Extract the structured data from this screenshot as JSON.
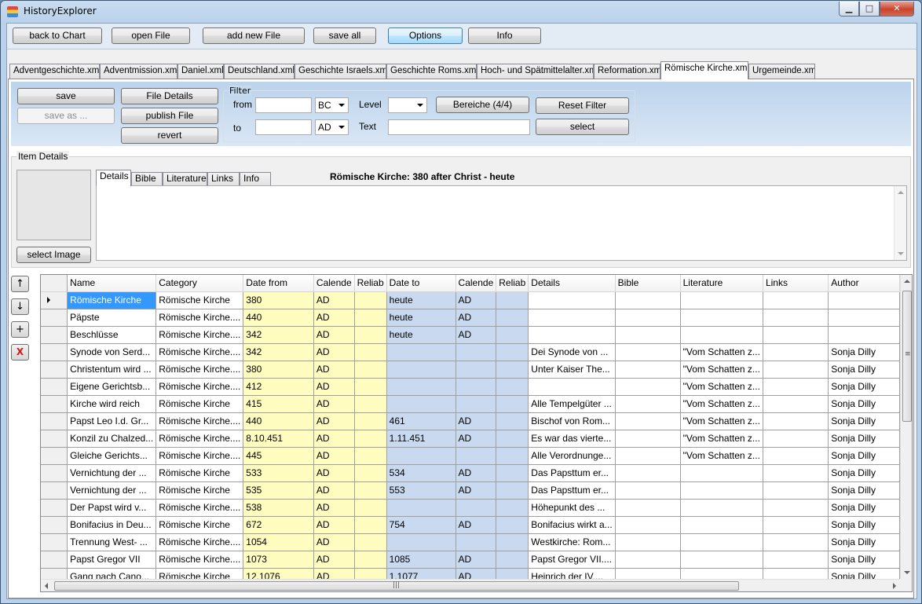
{
  "window": {
    "title": "HistoryExplorer",
    "minimize": "▁",
    "maximize": "□",
    "close": "✕"
  },
  "toolbar": {
    "back": "back to Chart",
    "open": "open File",
    "add": "add new File",
    "saveall": "save all",
    "options": "Options",
    "info": "Info"
  },
  "file_tabs": [
    "Adventgeschichte.xml",
    "Adventmission.xml",
    "Daniel.xml",
    "Deutschland.xml",
    "Geschichte Israels.xml",
    "Geschichte Roms.xml",
    "Hoch- und Spätmittelalter.xml",
    "Reformation.xml",
    "Römische Kirche.xml",
    "Urgemeinde.xml"
  ],
  "actions": {
    "save": "save",
    "save_as": "save as ...",
    "file_details": "File Details",
    "publish": "publish File",
    "revert": "revert"
  },
  "filter": {
    "legend": "Filter",
    "from_label": "from",
    "to_label": "to",
    "from_era": "BC",
    "to_era": "AD",
    "level_label": "Level",
    "level_value": "",
    "text_label": "Text",
    "bereiche": "Bereiche (4/4)",
    "reset": "Reset Filter",
    "select": "select"
  },
  "item_details": {
    "legend": "Item Details",
    "select_image": "select Image",
    "tabs": [
      "Details",
      "Bible",
      "Literature",
      "Links",
      "Info"
    ],
    "heading": "Römische Kirche:  380 after Christ  -  heute"
  },
  "side_buttons": {
    "up": "↑",
    "down": "↓",
    "add": "+",
    "delete": "X"
  },
  "grid": {
    "columns": [
      "Name",
      "Category",
      "Date from",
      "Calende",
      "Reliab",
      "Date to",
      "Calende",
      "Reliab",
      "Details",
      "Bible",
      "Literature",
      "Links",
      "Author"
    ],
    "rows": [
      [
        "Römische Kirche",
        "Römische Kirche",
        "380",
        "AD",
        "",
        "heute",
        "AD",
        "",
        "",
        "",
        "",
        "",
        ""
      ],
      [
        "Päpste",
        "Römische Kirche....",
        "440",
        "AD",
        "",
        "heute",
        "AD",
        "",
        "",
        "",
        "",
        "",
        ""
      ],
      [
        "Beschlüsse",
        "Römische Kirche....",
        "342",
        "AD",
        "",
        "heute",
        "AD",
        "",
        "",
        "",
        "",
        "",
        ""
      ],
      [
        "Synode von Serd...",
        "Römische Kirche....",
        "342",
        "AD",
        "",
        "",
        "",
        "",
        "Dei Synode von ...",
        "",
        "\"Vom Schatten z...",
        "",
        "Sonja Dilly"
      ],
      [
        "Christentum wird ...",
        "Römische Kirche....",
        "380",
        "AD",
        "",
        "",
        "",
        "",
        "Unter Kaiser The...",
        "",
        "\"Vom Schatten z...",
        "",
        "Sonja Dilly"
      ],
      [
        "Eigene Gerichtsb...",
        "Römische Kirche....",
        "412",
        "AD",
        "",
        "",
        "",
        "",
        "",
        "",
        "\"Vom Schatten z...",
        "",
        "Sonja Dilly"
      ],
      [
        "Kirche wird reich",
        "Römische Kirche",
        "415",
        "AD",
        "",
        "",
        "",
        "",
        "Alle Tempelgüter ...",
        "",
        "\"Vom Schatten z...",
        "",
        "Sonja Dilly"
      ],
      [
        "Papst Leo I.d. Gr...",
        "Römische Kirche....",
        "440",
        "AD",
        "",
        "461",
        "AD",
        "",
        "Bischof von Rom...",
        "",
        "\"Vom Schatten z...",
        "",
        "Sonja Dilly"
      ],
      [
        "Konzil zu Chalzed...",
        "Römische Kirche....",
        "8.10.451",
        "AD",
        "",
        "1.11.451",
        "AD",
        "",
        "Es war das vierte...",
        "",
        "\"Vom Schatten z...",
        "",
        "Sonja Dilly"
      ],
      [
        "Gleiche Gerichts...",
        "Römische Kirche....",
        "445",
        "AD",
        "",
        "",
        "",
        "",
        "Alle Verordnunge...",
        "",
        "\"Vom Schatten z...",
        "",
        "Sonja Dilly"
      ],
      [
        "Vernichtung der ...",
        "Römische Kirche",
        "533",
        "AD",
        "",
        "534",
        "AD",
        "",
        "Das Papsttum er...",
        "",
        "",
        "",
        "Sonja Dilly"
      ],
      [
        "Vernichtung der ...",
        "Römische Kirche",
        "535",
        "AD",
        "",
        "553",
        "AD",
        "",
        "Das Papsttum er...",
        "",
        "",
        "",
        "Sonja Dilly"
      ],
      [
        "Der Papst wird v...",
        "Römische Kirche....",
        "538",
        "AD",
        "",
        "",
        "",
        "",
        "Höhepunkt des ...",
        "",
        "",
        "",
        "Sonja Dilly"
      ],
      [
        "Bonifacius in Deu...",
        "Römische Kirche",
        "672",
        "AD",
        "",
        "754",
        "AD",
        "",
        "Bonifacius wirkt a...",
        "",
        "",
        "",
        "Sonja Dilly"
      ],
      [
        "Trennung West- ...",
        "Römische Kirche....",
        "1054",
        "AD",
        "",
        "",
        "",
        "",
        "Westkirche: Rom...",
        "",
        "",
        "",
        "Sonja Dilly"
      ],
      [
        "Papst Gregor VII",
        "Römische Kirche....",
        "1073",
        "AD",
        "",
        "1085",
        "AD",
        "",
        "Papst Gregor VII....",
        "",
        "",
        "",
        "Sonja Dilly"
      ],
      [
        "Gang nach Cano...",
        "Römische Kirche",
        "12.1076",
        "AD",
        "",
        "1.1077",
        "AD",
        "",
        "Heinrich der IV....",
        "",
        "",
        "",
        "Sonja Dilly"
      ]
    ]
  },
  "colors": {
    "date_from_bg": "#fffcc0",
    "date_to_bg": "#c9daf0",
    "selection": "#3399ff"
  }
}
